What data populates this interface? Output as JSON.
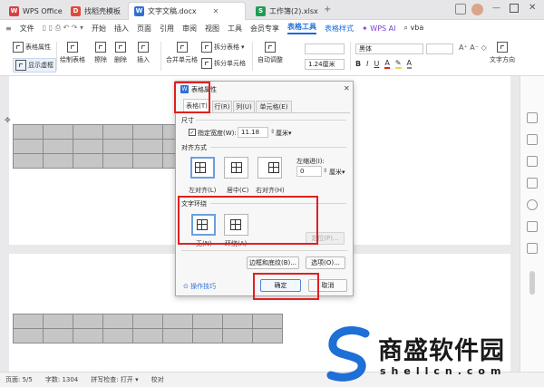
{
  "tabs": [
    {
      "label": "WPS Office",
      "icon": "wps-logo-icon",
      "color": "#d94040"
    },
    {
      "label": "找稻壳模板",
      "icon": "docer-icon",
      "color": "#e04a3a"
    },
    {
      "label": "文字文稿.docx",
      "icon": "writer-icon",
      "color": "#2f6fd8",
      "active": true
    },
    {
      "label": "工作簿(2).xlsx",
      "icon": "sheet-icon",
      "color": "#1f9d55"
    }
  ],
  "menu": {
    "file": "文件",
    "items": [
      "开始",
      "插入",
      "页面",
      "引用",
      "审阅",
      "视图",
      "工具",
      "会员专享"
    ],
    "table_tools": "表格工具",
    "table_style": "表格样式",
    "wps_ai": "WPS AI",
    "vba": "vba"
  },
  "toolbar": {
    "table_props": "表格属性",
    "show_gridlines": "显示虚框",
    "draw_table": "绘制表格",
    "erase": "擦除",
    "delete": "删除",
    "insert": "插入",
    "merge_cells": "合并单元格",
    "split_table": "拆分表格",
    "split_cells": "拆分单元格",
    "auto_fit": "自动调整",
    "size_value": "1.24厘米",
    "font_name": "黑体",
    "font_size": "",
    "text_direction": "文字方向"
  },
  "dialog": {
    "title": "表格属性",
    "tabs": [
      "表格(T)",
      "行(R)",
      "列(U)",
      "单元格(E)"
    ],
    "size_section": "尺寸",
    "pref_width_label": "指定宽度(W):",
    "pref_width_value": "11.18",
    "pref_width_unit": "厘米",
    "align_section": "对齐方式",
    "align_options": [
      "左对齐(L)",
      "居中(C)",
      "右对齐(H)"
    ],
    "left_indent_label": "左缩进(I):",
    "left_indent_value": "0",
    "left_indent_unit": "厘米",
    "wrap_section": "文字环绕",
    "wrap_options": [
      "无(N)",
      "环绕(A)"
    ],
    "position_button": "定位(P)...",
    "borders_button": "边框和底纹(B)...",
    "options_button": "选项(O)...",
    "tips_link": "操作技巧",
    "ok_button": "确定",
    "cancel_button": "取消"
  },
  "status": {
    "page": "页面: 5/5",
    "words": "字数: 1304",
    "spell": "拼写检查: 打开",
    "proof": "校对"
  },
  "watermark": {
    "brand": "商盛软件园",
    "url": "shellcn.com"
  }
}
